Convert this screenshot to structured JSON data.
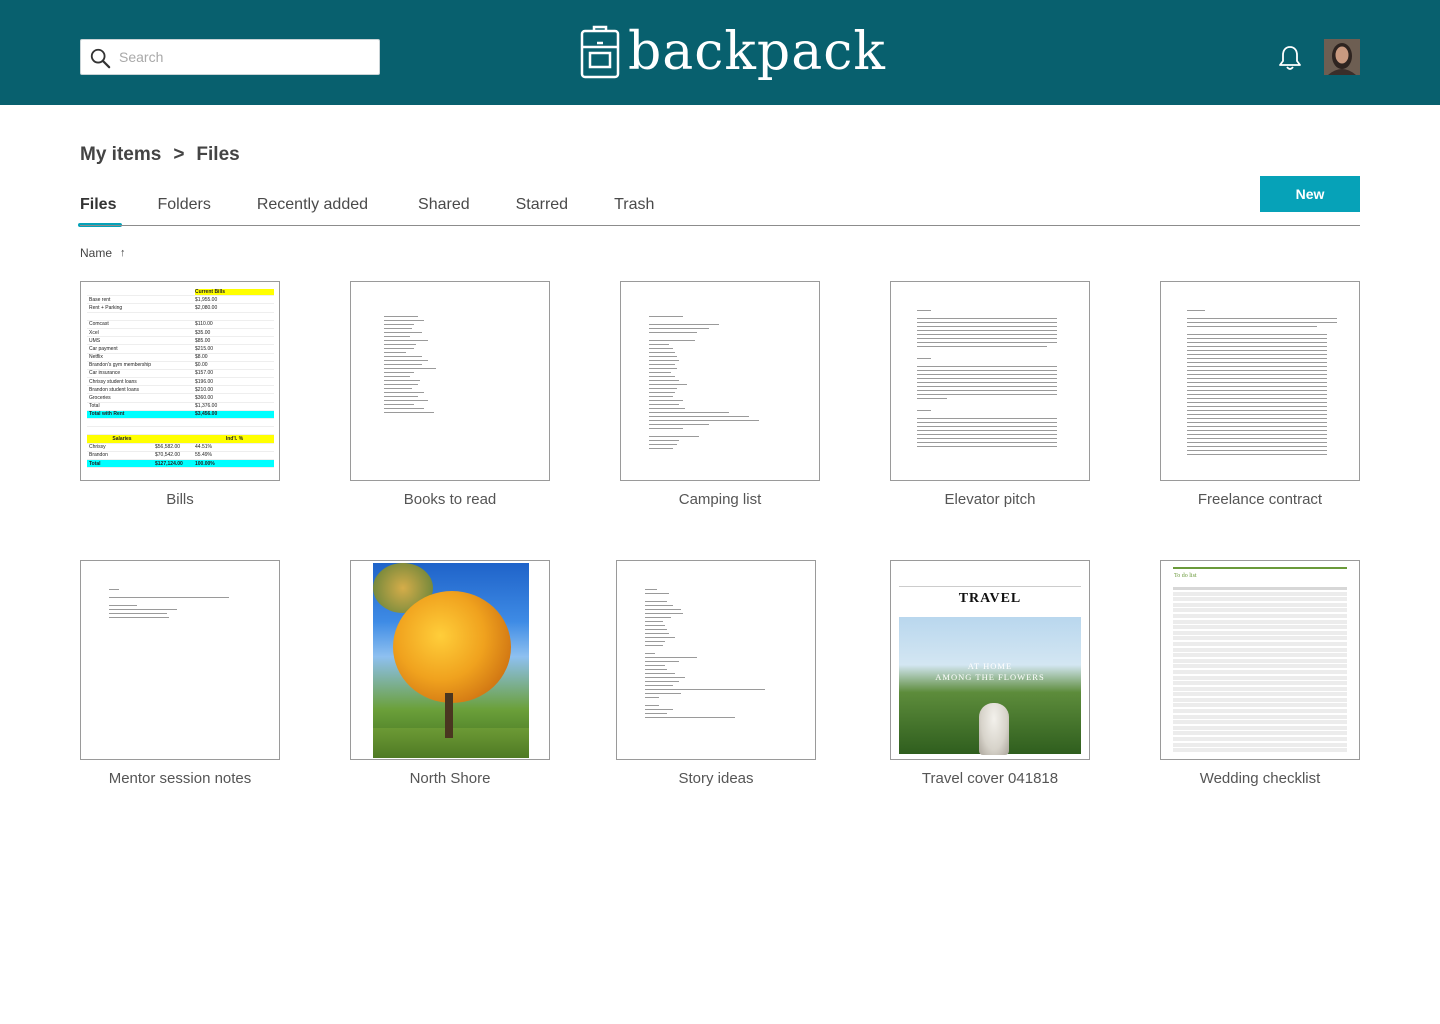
{
  "brand": {
    "name": "backpack"
  },
  "search": {
    "placeholder": "Search"
  },
  "breadcrumb": {
    "root": "My items",
    "separator": ">",
    "current": "Files"
  },
  "tabs": [
    {
      "label": "Files",
      "active": true
    },
    {
      "label": "Folders"
    },
    {
      "label": "Recently added"
    },
    {
      "label": "Shared"
    },
    {
      "label": "Starred"
    },
    {
      "label": "Trash"
    }
  ],
  "new_button": "New",
  "sort": {
    "label": "Name",
    "direction_icon": "↑"
  },
  "colors": {
    "header": "#08606e",
    "accent": "#06a2b8"
  },
  "files": [
    {
      "name": "Bills",
      "thumb": "spreadsheet"
    },
    {
      "name": "Books to read",
      "thumb": "document"
    },
    {
      "name": "Camping list",
      "thumb": "document"
    },
    {
      "name": "Elevator pitch",
      "thumb": "document"
    },
    {
      "name": "Freelance contract",
      "thumb": "document"
    },
    {
      "name": "Mentor session notes",
      "thumb": "document"
    },
    {
      "name": "North Shore",
      "thumb": "photo"
    },
    {
      "name": "Story ideas",
      "thumb": "document"
    },
    {
      "name": "Travel cover 041818",
      "thumb": "magazine-cover"
    },
    {
      "name": "Wedding checklist",
      "thumb": "checklist"
    }
  ],
  "thumbs": {
    "bills": {
      "header": "Current Bills",
      "rows": [
        [
          "Base rent",
          "",
          "$1,955.00"
        ],
        [
          "Rent + Parking",
          "",
          "$2,080.00"
        ],
        [
          "",
          "",
          ""
        ],
        [
          "Comcast",
          "",
          "$110.00"
        ],
        [
          "Xcel",
          "",
          "$35.00"
        ],
        [
          "UMS",
          "",
          "$85.00"
        ],
        [
          "Car payment",
          "",
          "$215.00"
        ],
        [
          "Netflix",
          "",
          "$8.00"
        ],
        [
          "Brandon's gym membership",
          "",
          "$0.00"
        ],
        [
          "Car insurance",
          "",
          "$157.00"
        ],
        [
          "Chrissy student loans",
          "",
          "$196.00"
        ],
        [
          "Brandon student loans",
          "",
          "$210.00"
        ],
        [
          "Groceries",
          "",
          "$360.00"
        ],
        [
          "Total",
          "",
          "$1,376.00"
        ]
      ],
      "total_with_rent": [
        "Total with Rent",
        "",
        "$3,456.00"
      ],
      "salaries_header": [
        "Salaries",
        "",
        "Ind'l. %"
      ],
      "salaries": [
        [
          "Chrissy",
          "$56,582.00",
          "44.51%"
        ],
        [
          "Brandon",
          "$70,542.00",
          "55.49%"
        ]
      ],
      "salaries_total": [
        "Total",
        "$127,124.00",
        "100.00%"
      ]
    },
    "travel": {
      "masthead": "TRAVEL",
      "headline_line1": "AT HOME",
      "headline_line2": "AMONG THE FLOWERS"
    },
    "wedding": {
      "title": "To do list"
    }
  }
}
